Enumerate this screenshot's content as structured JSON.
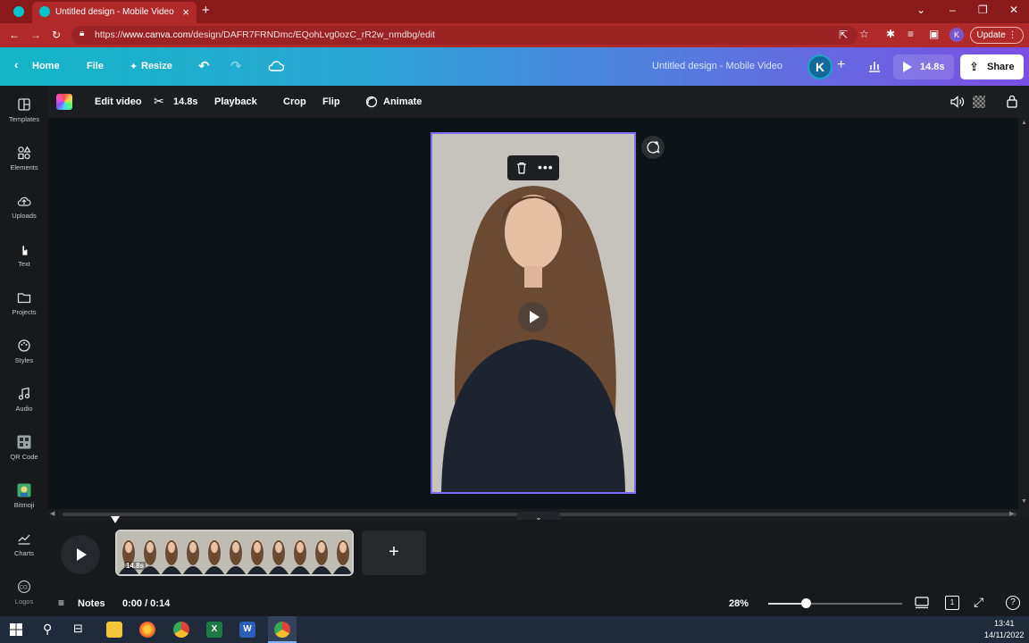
{
  "browser": {
    "tab_title": "Untitled design - Mobile Video",
    "url_prefix": "https://",
    "url_domain": "www.canva.com",
    "url_path": "/design/DAFR7FRNDmc/EQohLvg0ozC_rR2w_nmdbg/edit",
    "update_label": "Update",
    "profile_initial": "K"
  },
  "header": {
    "home": "Home",
    "file": "File",
    "resize": "Resize",
    "design_title": "Untitled design - Mobile Video",
    "avatar_initial": "K",
    "duration": "14.8s",
    "share": "Share"
  },
  "sidebar": {
    "items": [
      {
        "label": "Templates",
        "icon": "templates-icon"
      },
      {
        "label": "Elements",
        "icon": "elements-icon"
      },
      {
        "label": "Uploads",
        "icon": "uploads-icon"
      },
      {
        "label": "Text",
        "icon": "text-icon"
      },
      {
        "label": "Projects",
        "icon": "projects-icon"
      },
      {
        "label": "Styles",
        "icon": "styles-icon"
      },
      {
        "label": "Audio",
        "icon": "audio-icon"
      },
      {
        "label": "QR Code",
        "icon": "qr-code-icon"
      },
      {
        "label": "Bitmoji",
        "icon": "bitmoji-icon"
      },
      {
        "label": "Charts",
        "icon": "charts-icon"
      },
      {
        "label": "Logos",
        "icon": "logos-icon"
      }
    ]
  },
  "toolbar": {
    "edit_video": "Edit video",
    "trim_duration": "14.8s",
    "playback": "Playback",
    "crop": "Crop",
    "flip": "Flip",
    "animate": "Animate"
  },
  "timeline": {
    "clip_duration": "14.8s",
    "add_label": "+",
    "playhead_fraction": 0
  },
  "bottom": {
    "notes": "Notes",
    "time": "0:00 / 0:14",
    "zoom": "28%",
    "zoom_level": 0.28,
    "page_count": "1"
  },
  "taskbar": {
    "time": "13:41",
    "date": "14/11/2022"
  },
  "colors": {
    "tab_strip": "#8a1a1a",
    "address_bar": "#b02a2a",
    "header_start": "#12b6c6",
    "header_end": "#7b4fe3",
    "selection": "#7d6cf0"
  }
}
